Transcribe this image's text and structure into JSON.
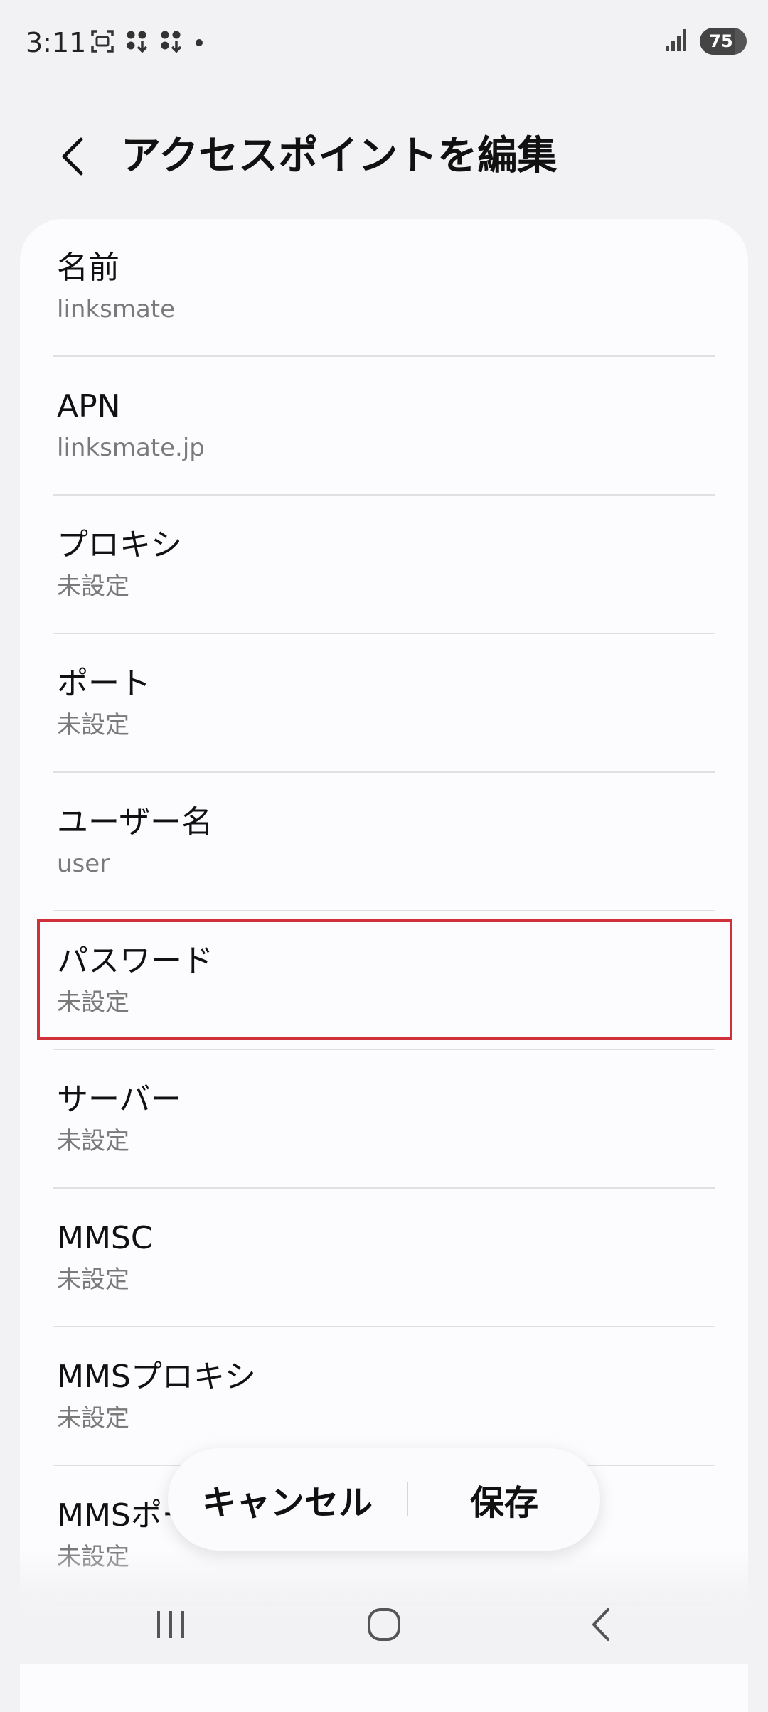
{
  "status_bar": {
    "time": "3:11",
    "battery_level": "75",
    "battery_fraction": 0.75,
    "icons_left": [
      "screenshot-icon",
      "app-notification-icon",
      "app-notification-icon",
      "dot-icon"
    ],
    "icons_right": [
      "signal-icon",
      "battery-icon"
    ]
  },
  "header": {
    "title": "アクセスポイントを編集",
    "back_icon": "chevron-left-icon"
  },
  "items": [
    {
      "label": "名前",
      "value": "linksmate"
    },
    {
      "label": "APN",
      "value": "linksmate.jp"
    },
    {
      "label": "プロキシ",
      "value": "未設定"
    },
    {
      "label": "ポート",
      "value": "未設定"
    },
    {
      "label": "ユーザー名",
      "value": "user"
    },
    {
      "label": "パスワード",
      "value": "未設定"
    },
    {
      "label": "サーバー",
      "value": "未設定"
    },
    {
      "label": "MMSC",
      "value": "未設定"
    },
    {
      "label": "MMSプロキシ",
      "value": "未設定"
    },
    {
      "label": "MMSポート",
      "value": "未設定"
    }
  ],
  "highlight": {
    "target": "パスワード",
    "color": "#d0303a"
  },
  "actions": {
    "cancel_label": "キャンセル",
    "save_label": "保存"
  },
  "nav_bar": {
    "icons": [
      "recent-apps-icon",
      "home-icon",
      "back-icon"
    ]
  },
  "colors": {
    "background": "#f2f2f4",
    "card": "#fcfcfe",
    "secondary_text": "#7a7a7a",
    "highlight": "#d0303a"
  }
}
